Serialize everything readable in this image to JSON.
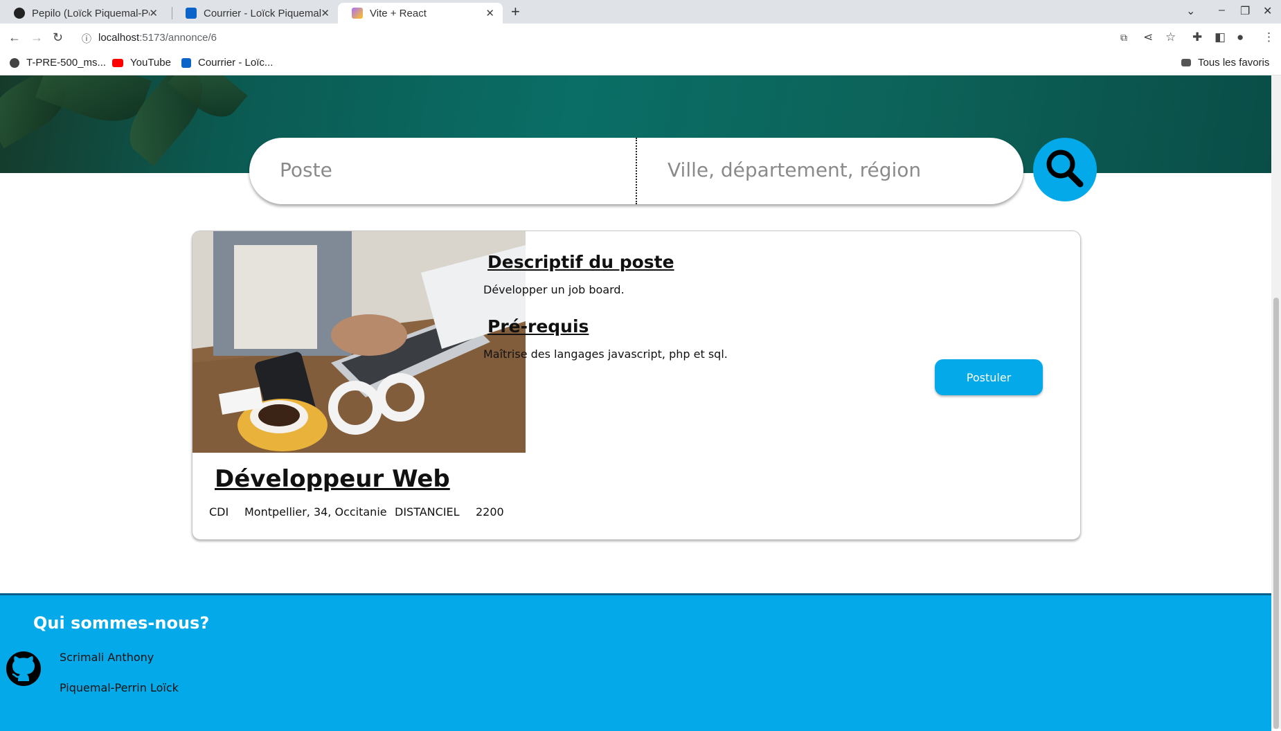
{
  "browser": {
    "tabs": [
      {
        "label": "Pepilo (Loïck Piquemal-Pe"
      },
      {
        "label": "Courrier - Loïck Piquemal"
      },
      {
        "label": "Vite + React"
      }
    ],
    "url_host": "localhost",
    "url_path": ":5173/annonce/6",
    "bookmarks": [
      {
        "label": "T-PRE-500_ms..."
      },
      {
        "label": "YouTube"
      },
      {
        "label": "Courrier - Loïc..."
      }
    ],
    "all_bookmarks": "Tous les favoris"
  },
  "search": {
    "job_placeholder": "Poste",
    "location_placeholder": "Ville, département, région"
  },
  "job": {
    "desc_heading": "Descriptif du poste",
    "desc_text": "Développer un job board.",
    "req_heading": "Pré-requis",
    "req_text": "Maîtrise des langages javascript, php et sql.",
    "apply_label": "Postuler",
    "title": "Développeur Web",
    "contract": "CDI",
    "location": "Montpellier, 34, Occitanie",
    "company": "DISTANCIEL",
    "salary": "2200"
  },
  "footer": {
    "title": "Qui sommes-nous?",
    "members": [
      "Scrimali Anthony",
      "Piquemal-Perrin Loïck"
    ]
  },
  "colors": {
    "accent": "#03a9e8"
  }
}
